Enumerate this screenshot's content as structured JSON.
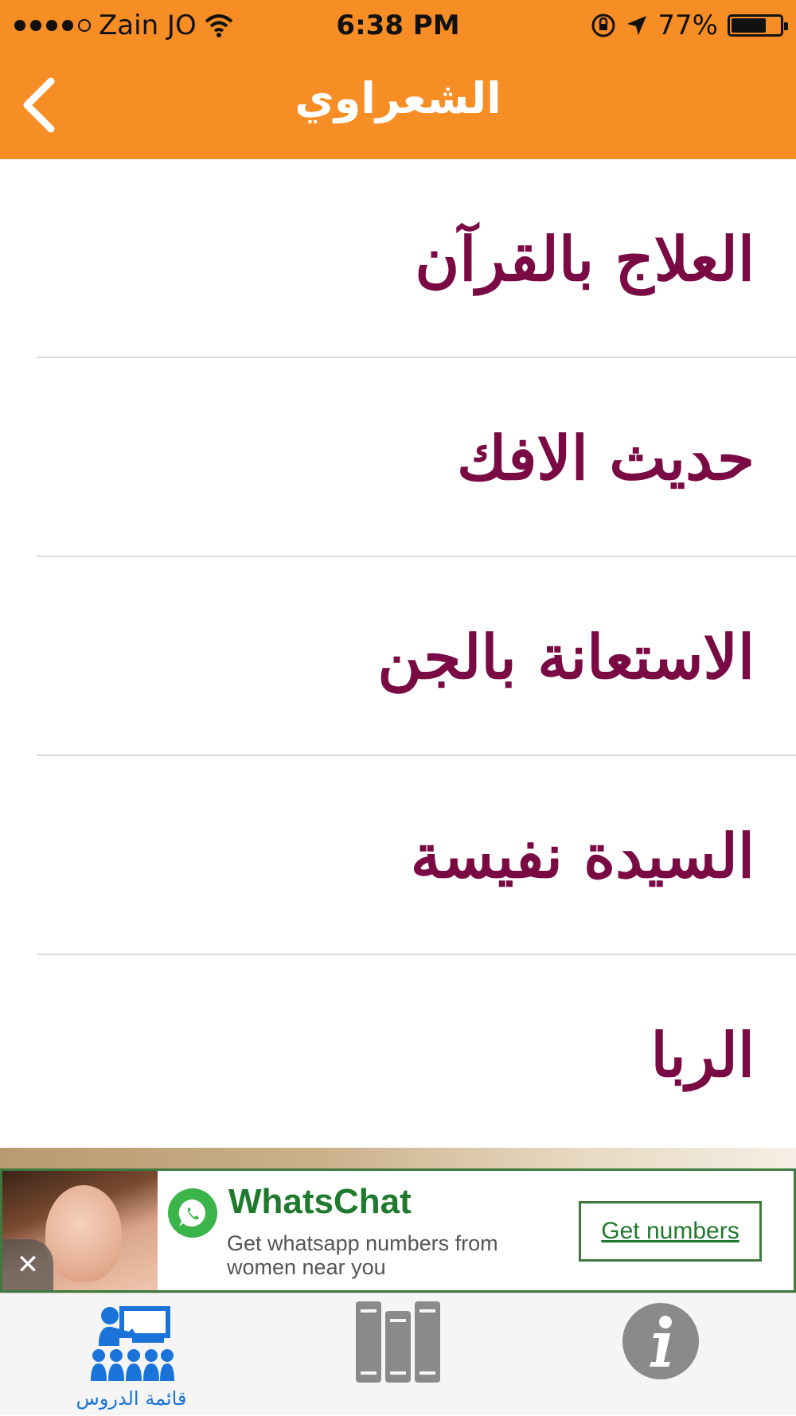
{
  "status_bar": {
    "carrier": "Zain JO",
    "time": "6:38 PM",
    "battery_percent": "77%",
    "battery_level": 0.77,
    "icons": [
      "signal-dots-icon",
      "wifi-icon",
      "orientation-lock-icon",
      "location-arrow-icon",
      "battery-icon"
    ]
  },
  "nav": {
    "title": "الشعراوي",
    "back_icon": "chevron-left-icon"
  },
  "lessons": [
    {
      "label": "العلاج بالقرآن"
    },
    {
      "label": "حديث الافك"
    },
    {
      "label": "الاستعانة بالجن"
    },
    {
      "label": "السيدة نفيسة"
    },
    {
      "label": "الربا"
    }
  ],
  "ad": {
    "title": "WhatsChat",
    "description": "Get whatsapp numbers from women near you",
    "cta": "Get numbers",
    "close_symbol": "✕"
  },
  "tabbar": {
    "tabs": [
      {
        "label": "قائمة الدروس",
        "icon": "lesson-list-icon",
        "selected": true
      },
      {
        "label": "",
        "icon": "library-books-icon",
        "selected": false
      },
      {
        "label": "",
        "icon": "info-icon",
        "selected": false
      }
    ]
  },
  "colors": {
    "accent_orange": "#f78d25",
    "lesson_text": "#7a0a44",
    "tab_active": "#1a73d9",
    "tab_inactive": "#8a8a8a",
    "ad_green": "#1f7a2e"
  }
}
